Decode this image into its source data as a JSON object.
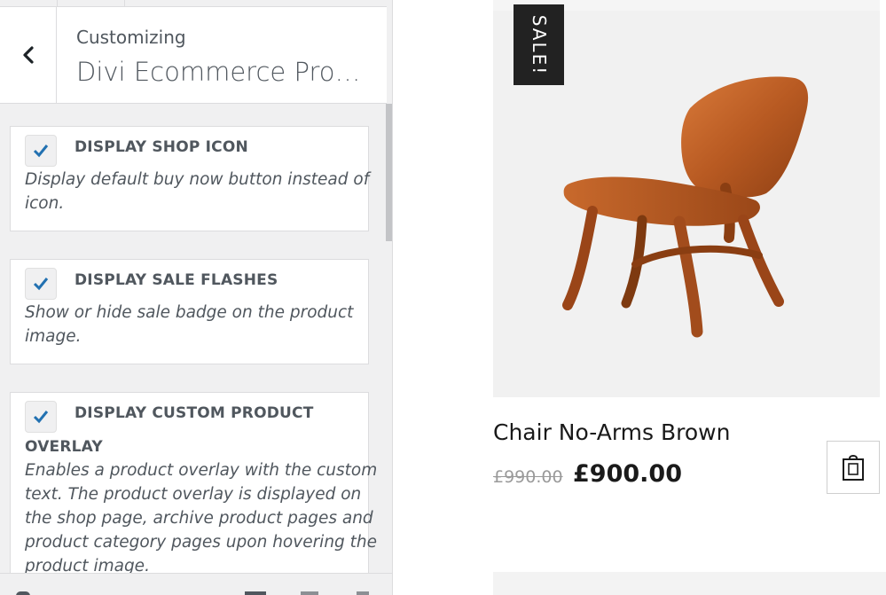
{
  "customizer": {
    "breadcrumb": "Customizing",
    "section_title": "Divi Ecommerce Product Settings",
    "controls": [
      {
        "label": "DISPLAY SHOP ICON",
        "checked": true,
        "description_lines": [
          "Display default buy now button instead of",
          "icon."
        ]
      },
      {
        "label": "DISPLAY SALE FLASHES",
        "checked": true,
        "description_lines": [
          "Show or hide sale badge on the product",
          "image."
        ]
      },
      {
        "label_line1": "DISPLAY CUSTOM PRODUCT",
        "label_line2": "OVERLAY",
        "checked": true,
        "description_lines": [
          "Enables a product overlay with the custom",
          "text. The product overlay is displayed on",
          "the shop page, archive product pages and",
          "product category pages upon hovering the",
          "product image."
        ]
      }
    ],
    "colors": {
      "check": "#2271b1",
      "text": "#50575e"
    }
  },
  "preview": {
    "sale_badge": "SALE!",
    "product_title": "Chair No-Arms Brown",
    "old_price": "£990.00",
    "new_price": "£900.00",
    "icons": {
      "cart": "shopping-bag-icon",
      "back": "chevron-left-icon"
    }
  }
}
